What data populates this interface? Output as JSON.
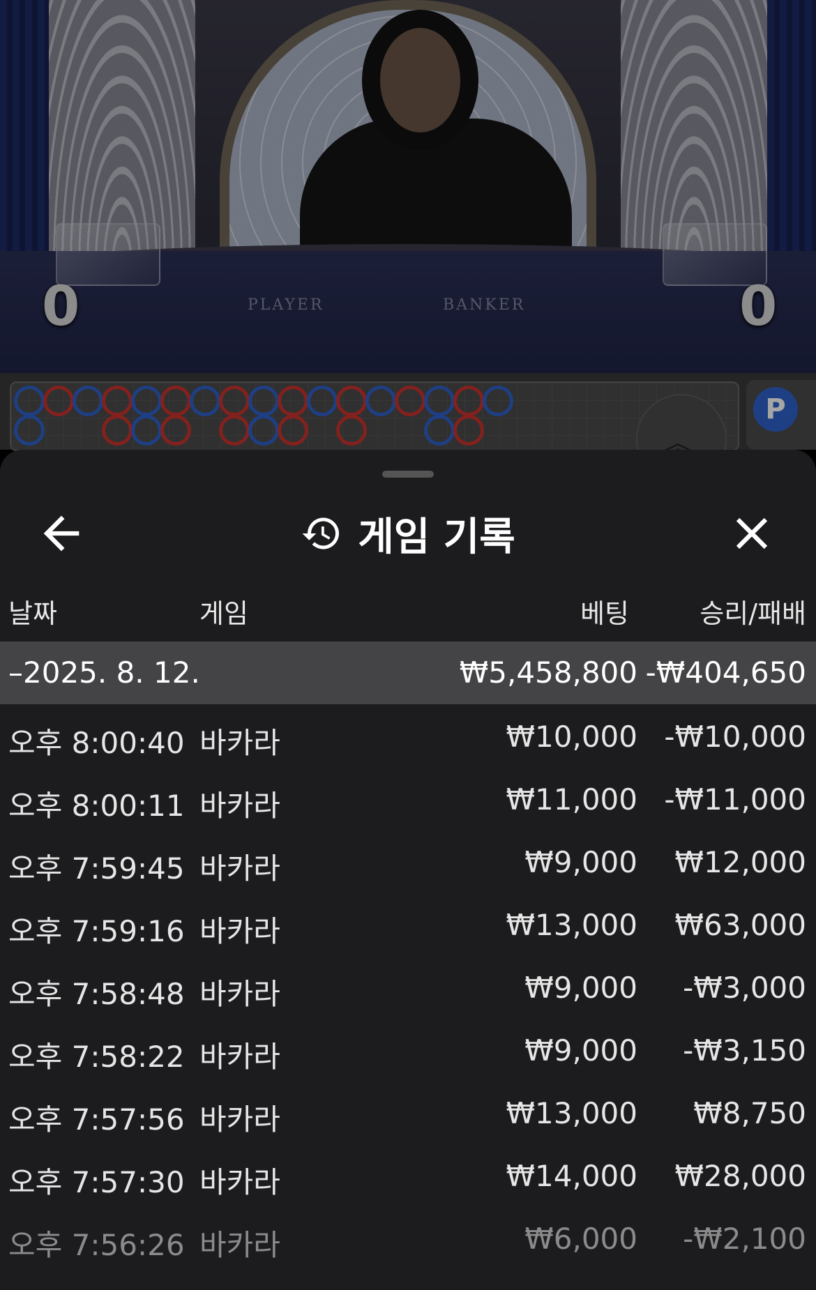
{
  "video": {
    "table_labels": {
      "player": "PLAYER",
      "banker": "BANKER"
    },
    "player_score": "0",
    "banker_score": "0"
  },
  "road": {
    "side_panel_label": "P",
    "beads": [
      {
        "c": "b",
        "col": 0,
        "row": 0
      },
      {
        "c": "r",
        "col": 1,
        "row": 0
      },
      {
        "c": "b",
        "col": 2,
        "row": 0
      },
      {
        "c": "r",
        "col": 3,
        "row": 0
      },
      {
        "c": "b",
        "col": 4,
        "row": 0
      },
      {
        "c": "r",
        "col": 5,
        "row": 0
      },
      {
        "c": "b",
        "col": 6,
        "row": 0
      },
      {
        "c": "r",
        "col": 7,
        "row": 0
      },
      {
        "c": "b",
        "col": 8,
        "row": 0
      },
      {
        "c": "r",
        "col": 9,
        "row": 0
      },
      {
        "c": "b",
        "col": 10,
        "row": 0
      },
      {
        "c": "r",
        "col": 11,
        "row": 0
      },
      {
        "c": "b",
        "col": 12,
        "row": 0
      },
      {
        "c": "r",
        "col": 13,
        "row": 0
      },
      {
        "c": "b",
        "col": 14,
        "row": 0
      },
      {
        "c": "r",
        "col": 15,
        "row": 0
      },
      {
        "c": "b",
        "col": 16,
        "row": 0
      },
      {
        "c": "b",
        "col": 0,
        "row": 1
      },
      {
        "c": "r",
        "col": 3,
        "row": 1
      },
      {
        "c": "b",
        "col": 4,
        "row": 1
      },
      {
        "c": "r",
        "col": 5,
        "row": 1
      },
      {
        "c": "r",
        "col": 7,
        "row": 1
      },
      {
        "c": "b",
        "col": 8,
        "row": 1
      },
      {
        "c": "r",
        "col": 9,
        "row": 1
      },
      {
        "c": "r",
        "col": 11,
        "row": 1
      },
      {
        "c": "b",
        "col": 14,
        "row": 1
      },
      {
        "c": "r",
        "col": 15,
        "row": 1
      }
    ]
  },
  "sheet": {
    "title": "게임 기록",
    "columns": {
      "date": "날짜",
      "game": "게임",
      "bet": "베팅",
      "win_loss": "승리/패배"
    },
    "day": {
      "date": "–2025. 8. 12.",
      "bet": "₩5,458,800",
      "win_loss": "-₩404,650"
    },
    "rows": [
      {
        "time": "오후 8:00:40",
        "game": "바카라",
        "bet": "₩10,000",
        "win_loss": "-₩10,000"
      },
      {
        "time": "오후 8:00:11",
        "game": "바카라",
        "bet": "₩11,000",
        "win_loss": "-₩11,000"
      },
      {
        "time": "오후 7:59:45",
        "game": "바카라",
        "bet": "₩9,000",
        "win_loss": "₩12,000"
      },
      {
        "time": "오후 7:59:16",
        "game": "바카라",
        "bet": "₩13,000",
        "win_loss": "₩63,000"
      },
      {
        "time": "오후 7:58:48",
        "game": "바카라",
        "bet": "₩9,000",
        "win_loss": "-₩3,000"
      },
      {
        "time": "오후 7:58:22",
        "game": "바카라",
        "bet": "₩9,000",
        "win_loss": "-₩3,150"
      },
      {
        "time": "오후 7:57:56",
        "game": "바카라",
        "bet": "₩13,000",
        "win_loss": "₩8,750"
      },
      {
        "time": "오후 7:57:30",
        "game": "바카라",
        "bet": "₩14,000",
        "win_loss": "₩28,000"
      },
      {
        "time": "오후 7:56:26",
        "game": "바카라",
        "bet": "₩6,000",
        "win_loss": "-₩2,100"
      }
    ]
  },
  "colors": {
    "sheet_bg": "#1c1c1e",
    "day_row_bg": "#444446",
    "banker_red": "#c9332f",
    "player_blue": "#2f62c9"
  },
  "icons": [
    "back-arrow-icon",
    "history-icon",
    "close-icon",
    "chevron-up-icon"
  ]
}
